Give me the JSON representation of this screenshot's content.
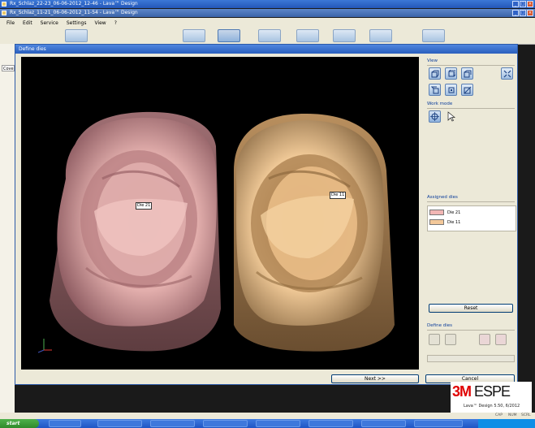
{
  "windows": {
    "back_title": "Rx_Schlaz_22-23_06-06-2012_12-46 - Lava™ Design",
    "front_title": "Rx_Schlaz_11-21_06-06-2012_11-54 - Lava™ Design"
  },
  "menu": [
    "File",
    "Edit",
    "Service",
    "Settings",
    "View",
    "?"
  ],
  "left_tab": "Cove",
  "dialog": {
    "title": "Define dies",
    "viewport": {
      "background": "#000000",
      "dies": [
        {
          "label": "Die 21",
          "color": "#d99a98"
        },
        {
          "label": "Die 11",
          "color": "#e9bd86"
        }
      ],
      "axis_labels": [
        "y",
        "x",
        "z"
      ]
    },
    "panel": {
      "view_label": "View",
      "view_icons": [
        "view-front-icon",
        "view-back-icon",
        "view-left-icon",
        "view-fit-icon",
        "view-right-icon",
        "view-top-icon",
        "view-bottom-icon"
      ],
      "work_mode_label": "Work mode",
      "work_mode_icons": [
        "rotate-tool-icon",
        "select-cursor-icon"
      ],
      "assigned_dies_label": "Assigned dies",
      "assigned_dies": [
        {
          "label": "Die 21",
          "color": "#f2b6b4"
        },
        {
          "label": "Die 11",
          "color": "#f3c89a"
        }
      ],
      "reset_label": "Reset",
      "define_dies_label": "Define dies",
      "define_icons": [
        "die-add-icon",
        "die-edit-icon",
        "die-split-icon",
        "die-remove-icon"
      ]
    },
    "next_label": "Next >>",
    "cancel_label": "Cancel"
  },
  "brand": {
    "logo_3m": "3M",
    "logo_espe": " ESPE",
    "version": "Lava™ Design 5.50, 6/2012"
  },
  "status": {
    "cap": "CAP",
    "num": "NUM",
    "scrl": "SCRL"
  },
  "taskbar": {
    "start_label": "start"
  }
}
